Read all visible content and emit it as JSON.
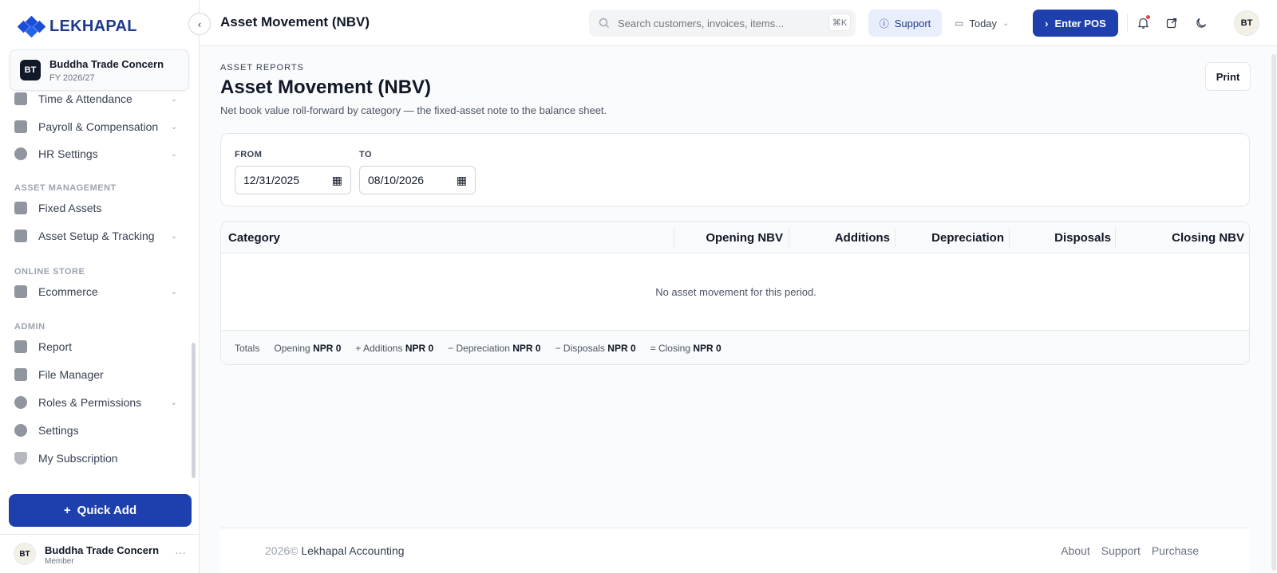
{
  "brand": {
    "name": "LEKHAPAL"
  },
  "org": {
    "initials": "BT",
    "name": "Buddha Trade Concern",
    "fy": "FY 2026/27"
  },
  "sidebar": {
    "items": [
      {
        "label": "Time & Attendance",
        "icon": "clock-icon",
        "chevron": true
      },
      {
        "label": "Payroll & Compensation",
        "icon": "payroll-icon",
        "chevron": true
      },
      {
        "label": "HR Settings",
        "icon": "gear-icon",
        "chevron": true
      },
      {
        "label": "Fixed Assets",
        "icon": "archive-icon",
        "chevron": false
      },
      {
        "label": "Asset Setup & Tracking",
        "icon": "sliders-icon",
        "chevron": true
      },
      {
        "label": "Ecommerce",
        "icon": "store-icon",
        "chevron": true
      },
      {
        "label": "Report",
        "icon": "bar-chart-icon",
        "chevron": false
      },
      {
        "label": "File Manager",
        "icon": "folder-icon",
        "chevron": false
      },
      {
        "label": "Roles & Permissions",
        "icon": "users-icon",
        "chevron": true
      },
      {
        "label": "Settings",
        "icon": "cog-icon",
        "chevron": false
      },
      {
        "label": "My Subscription",
        "icon": "shield-icon",
        "chevron": false
      }
    ],
    "sections": {
      "asset": "ASSET MANAGEMENT",
      "store": "ONLINE STORE",
      "admin": "ADMIN"
    },
    "quick_add": "Quick Add"
  },
  "user": {
    "initials": "BT",
    "name": "Buddha Trade Concern",
    "role": "Member"
  },
  "topbar": {
    "title": "Asset Movement (NBV)",
    "search_placeholder": "Search customers, invoices, items...",
    "search_shortcut": "⌘K",
    "support": "Support",
    "today": "Today",
    "enter_pos": "Enter POS",
    "avatar": "BT"
  },
  "page": {
    "eyebrow": "ASSET REPORTS",
    "title": "Asset Movement (NBV)",
    "subtitle": "Net book value roll-forward by category — the fixed-asset note to the balance sheet.",
    "print": "Print"
  },
  "filters": {
    "from_label": "FROM",
    "from_value": "12/31/2025",
    "to_label": "TO",
    "to_value": "08/10/2026"
  },
  "table": {
    "columns": [
      "Category",
      "Opening NBV",
      "Additions",
      "Depreciation",
      "Disposals",
      "Closing NBV"
    ],
    "empty": "No asset movement for this period.",
    "totals": {
      "label": "Totals",
      "opening_label": "Opening",
      "opening": "NPR 0",
      "additions_label": "+ Additions",
      "additions": "NPR 0",
      "depreciation_label": "− Depreciation",
      "depreciation": "NPR 0",
      "disposals_label": "− Disposals",
      "disposals": "NPR 0",
      "closing_label": "= Closing",
      "closing": "NPR 0"
    }
  },
  "footer": {
    "year": "2026©",
    "company": "Lekhapal Accounting",
    "links": [
      "About",
      "Support",
      "Purchase"
    ]
  },
  "colors": {
    "primary": "#1e40af",
    "brand": "#1d4ed8",
    "alert_dot": "#ef4444"
  }
}
